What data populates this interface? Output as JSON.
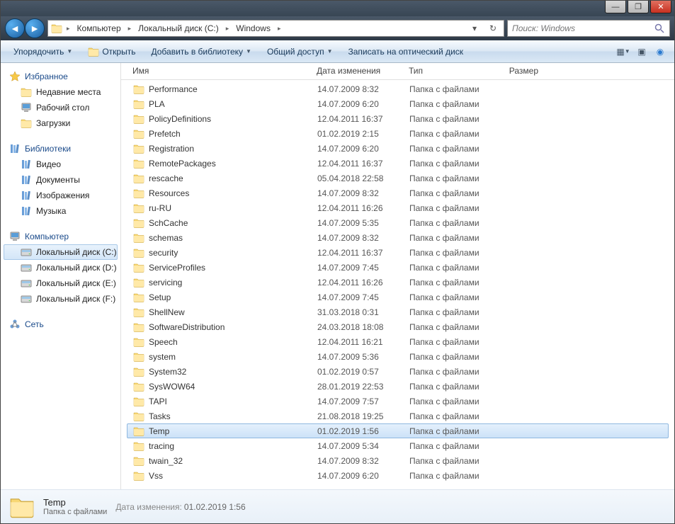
{
  "titlebar": {
    "min": "—",
    "max": "❐",
    "close": "✕"
  },
  "nav": {
    "crumbs": [
      "Компьютер",
      "Локальный диск (C:)",
      "Windows"
    ],
    "search_placeholder": "Поиск: Windows"
  },
  "toolbar": {
    "organize": "Упорядочить",
    "open": "Открыть",
    "library": "Добавить в библиотеку",
    "share": "Общий доступ",
    "burn": "Записать на оптический диск"
  },
  "sidebar": {
    "favorites": {
      "label": "Избранное",
      "items": [
        "Недавние места",
        "Рабочий стол",
        "Загрузки"
      ]
    },
    "libraries": {
      "label": "Библиотеки",
      "items": [
        "Видео",
        "Документы",
        "Изображения",
        "Музыка"
      ]
    },
    "computer": {
      "label": "Компьютер",
      "items": [
        "Локальный диск (C:)",
        "Локальный диск (D:)",
        "Локальный диск (E:)",
        "Локальный диск (F:)"
      ]
    },
    "network": {
      "label": "Сеть"
    }
  },
  "columns": {
    "name": "Имя",
    "date": "Дата изменения",
    "type": "Тип",
    "size": "Размер"
  },
  "folder_type": "Папка с файлами",
  "files": [
    {
      "name": "Performance",
      "date": "14.07.2009 8:32"
    },
    {
      "name": "PLA",
      "date": "14.07.2009 6:20"
    },
    {
      "name": "PolicyDefinitions",
      "date": "12.04.2011 16:37"
    },
    {
      "name": "Prefetch",
      "date": "01.02.2019 2:15"
    },
    {
      "name": "Registration",
      "date": "14.07.2009 6:20"
    },
    {
      "name": "RemotePackages",
      "date": "12.04.2011 16:37"
    },
    {
      "name": "rescache",
      "date": "05.04.2018 22:58"
    },
    {
      "name": "Resources",
      "date": "14.07.2009 8:32"
    },
    {
      "name": "ru-RU",
      "date": "12.04.2011 16:26"
    },
    {
      "name": "SchCache",
      "date": "14.07.2009 5:35"
    },
    {
      "name": "schemas",
      "date": "14.07.2009 8:32"
    },
    {
      "name": "security",
      "date": "12.04.2011 16:37"
    },
    {
      "name": "ServiceProfiles",
      "date": "14.07.2009 7:45"
    },
    {
      "name": "servicing",
      "date": "12.04.2011 16:26"
    },
    {
      "name": "Setup",
      "date": "14.07.2009 7:45"
    },
    {
      "name": "ShellNew",
      "date": "31.03.2018 0:31"
    },
    {
      "name": "SoftwareDistribution",
      "date": "24.03.2018 18:08"
    },
    {
      "name": "Speech",
      "date": "12.04.2011 16:21"
    },
    {
      "name": "system",
      "date": "14.07.2009 5:36"
    },
    {
      "name": "System32",
      "date": "01.02.2019 0:57"
    },
    {
      "name": "SysWOW64",
      "date": "28.01.2019 22:53"
    },
    {
      "name": "TAPI",
      "date": "14.07.2009 7:57"
    },
    {
      "name": "Tasks",
      "date": "21.08.2018 19:25"
    },
    {
      "name": "Temp",
      "date": "01.02.2019 1:56",
      "selected": true
    },
    {
      "name": "tracing",
      "date": "14.07.2009 5:34"
    },
    {
      "name": "twain_32",
      "date": "14.07.2009 8:32"
    },
    {
      "name": "Vss",
      "date": "14.07.2009 6:20"
    }
  ],
  "details": {
    "title": "Temp",
    "subtitle": "Папка с файлами",
    "date_label": "Дата изменения:",
    "date_value": "01.02.2019 1:56"
  }
}
